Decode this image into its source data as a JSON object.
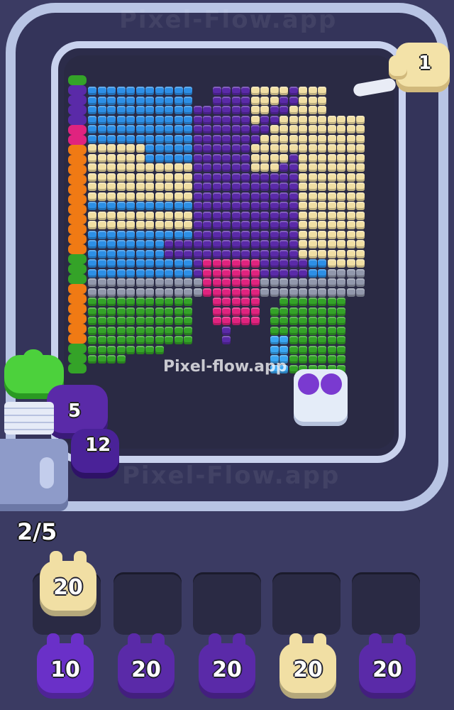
{
  "watermark": {
    "top": "Pixel-Flow.app",
    "bottom": "Pixel-Flow.app",
    "center": "Pixel-flow.app",
    "side": "Pixel-Flow.app"
  },
  "pusher": {
    "count": "1"
  },
  "launcher": {
    "top_count": "5",
    "bottom_count": "12",
    "counter": "2/5"
  },
  "slots": {
    "top": [
      {
        "value": "20",
        "color": "cream"
      },
      {
        "value": "",
        "color": "empty"
      },
      {
        "value": "",
        "color": "empty"
      },
      {
        "value": "",
        "color": "empty"
      },
      {
        "value": "",
        "color": "empty"
      }
    ],
    "bottom": [
      {
        "value": "10",
        "color": "purple"
      },
      {
        "value": "20",
        "color": "purple"
      },
      {
        "value": "20",
        "color": "purple"
      },
      {
        "value": "20",
        "color": "cream"
      },
      {
        "value": "20",
        "color": "purple"
      }
    ]
  },
  "colors": {
    "cream": "#f1dfa4",
    "purple": "#5a2aa8",
    "blue": "#2d8fe6",
    "lightblue": "#3aa6f2",
    "magenta": "#e0237f",
    "gray": "#9298ac",
    "green": "#34a328",
    "orange": "#f07a14",
    "empty": "#2a2a44"
  }
}
